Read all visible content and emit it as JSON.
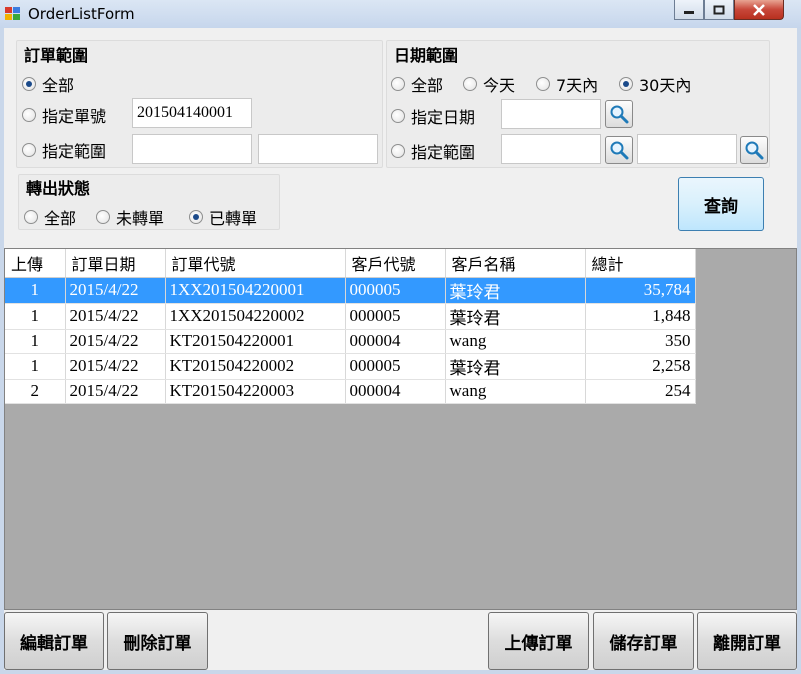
{
  "window": {
    "title": "OrderListForm"
  },
  "order_range": {
    "label": "訂單範圍",
    "options": [
      {
        "label": "全部",
        "selected": true
      },
      {
        "label": "指定單號",
        "selected": false
      },
      {
        "label": "指定範圍",
        "selected": false
      }
    ],
    "order_no_value": "201504140001",
    "range_from_value": "",
    "range_to_value": ""
  },
  "date_range": {
    "label": "日期範圍",
    "quick_options": [
      {
        "label": "全部",
        "selected": false
      },
      {
        "label": "今天",
        "selected": false
      },
      {
        "label": "7天內",
        "selected": false
      },
      {
        "label": "30天內",
        "selected": true
      }
    ],
    "specific_label": "指定日期",
    "range_label": "指定範圍",
    "specific_value": "",
    "range_from_value": "",
    "range_to_value": ""
  },
  "transfer_status": {
    "label": "轉出狀態",
    "options": [
      {
        "label": "全部",
        "selected": false
      },
      {
        "label": "未轉單",
        "selected": false
      },
      {
        "label": "已轉單",
        "selected": true
      }
    ]
  },
  "query_button": "查詢",
  "grid": {
    "columns": [
      "上傳",
      "訂單日期",
      "訂單代號",
      "客戶代號",
      "客戶名稱",
      "總計"
    ],
    "rows": [
      {
        "upload": "1",
        "date": "2015/4/22",
        "order_id": "1XX201504220001",
        "customer_id": "000005",
        "customer_name": "葉玲君",
        "total": "35,784",
        "selected": true
      },
      {
        "upload": "1",
        "date": "2015/4/22",
        "order_id": "1XX201504220002",
        "customer_id": "000005",
        "customer_name": "葉玲君",
        "total": "1,848",
        "selected": false
      },
      {
        "upload": "1",
        "date": "2015/4/22",
        "order_id": "KT201504220001",
        "customer_id": "000004",
        "customer_name": "wang",
        "total": "350",
        "selected": false
      },
      {
        "upload": "1",
        "date": "2015/4/22",
        "order_id": "KT201504220002",
        "customer_id": "000005",
        "customer_name": "葉玲君",
        "total": "2,258",
        "selected": false
      },
      {
        "upload": "2",
        "date": "2015/4/22",
        "order_id": "KT201504220003",
        "customer_id": "000004",
        "customer_name": "wang",
        "total": "254",
        "selected": false
      }
    ]
  },
  "buttons": {
    "edit": "編輯訂單",
    "delete": "刪除訂單",
    "upload": "上傳訂單",
    "save": "儲存訂單",
    "exit": "離開訂單"
  },
  "icons": {
    "search": "magnifier-icon",
    "minimize": "minimize-icon",
    "maximize": "maximize-icon",
    "close": "close-icon"
  },
  "colors": {
    "selection": "#3399ff",
    "grid_background": "#aaaaaa",
    "close_button": "#c8473a"
  }
}
